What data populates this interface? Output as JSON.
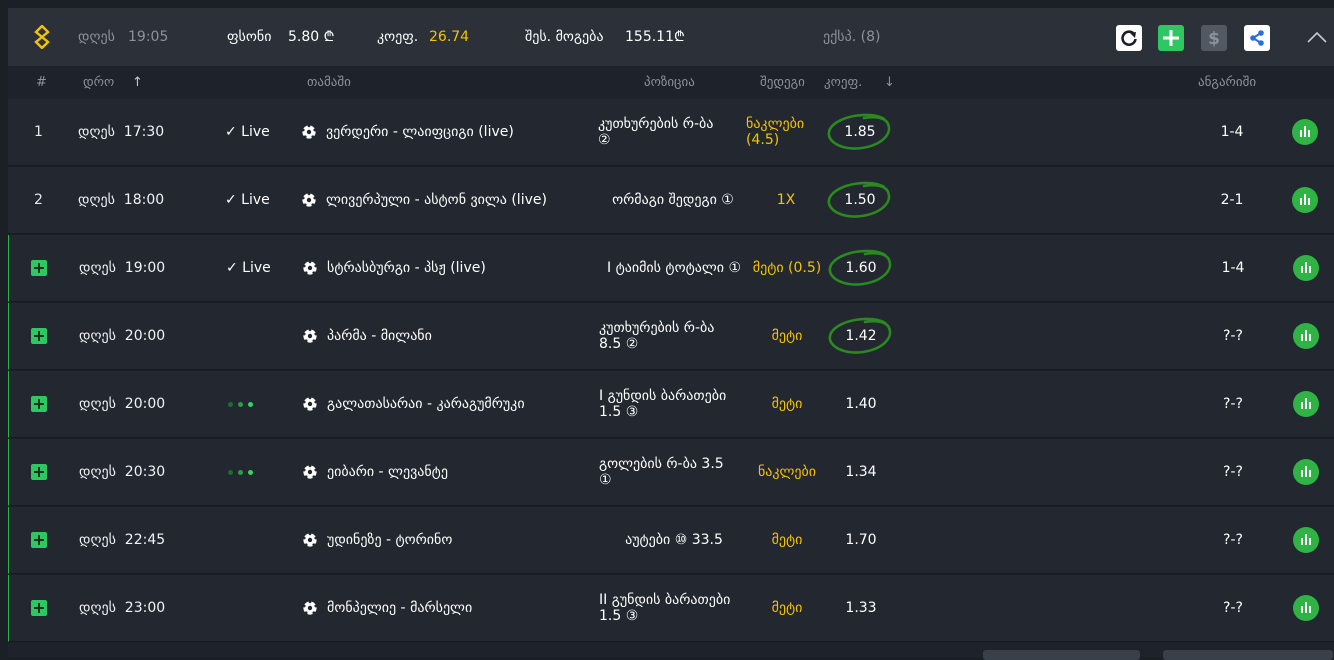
{
  "topbar": {
    "day": "დღეს",
    "time": "19:05",
    "bonus_label": "ფსონი",
    "bonus_value": "5.80 ₾",
    "coef_label": "კოეფ.",
    "coef_value": "26.74",
    "win_label": "შეს. მოგება",
    "win_value": "155.11₾",
    "express_label": "ექსპ. (8)",
    "icons": [
      "logo-icon",
      "refresh-icon",
      "add-icon",
      "dollar-icon",
      "share-icon",
      "chevron-up-icon"
    ],
    "colors": {
      "accent_yellow": "#f5c400",
      "accent_green": "#2fb344"
    }
  },
  "header": {
    "num": "#",
    "date": "დრო",
    "sort_up": "↑",
    "game": "თამაში",
    "position": "პოზიცია",
    "result": "შედეგი",
    "coef": "კოეფ.",
    "sort_down": "↓",
    "account": "ანგარიში"
  },
  "rows": [
    {
      "num": "1",
      "day": "დღეს",
      "time": "17:30",
      "live": "✓ Live",
      "match": "ვერდერი - ლაიფციგი (live)",
      "pos1": "კუთხურების რ-ბა",
      "pos2": "②",
      "sel1": "ნაკლები",
      "sel2": "(4.5)",
      "odd": "1.85",
      "score": "1-4"
    },
    {
      "num": "2",
      "day": "დღეს",
      "time": "18:00",
      "live": "✓ Live",
      "match": "ლივერპული - ასტონ ვილა (live)",
      "pos1": "ორმაგი შედეგი ①",
      "pos2": "",
      "sel1": "1X",
      "sel2": "",
      "odd": "1.50",
      "score": "2-1"
    },
    {
      "num": "",
      "day": "დღეს",
      "time": "19:00",
      "live": "✓ Live",
      "match": "სტრასბურგი - პსჟ (live)",
      "pos1": "I ტაიმის ტოტალი ①",
      "pos2": "",
      "sel1": "მეტი (0.5)",
      "sel2": "",
      "odd": "1.60",
      "score": "1-4"
    },
    {
      "num": "",
      "day": "დღეს",
      "time": "20:00",
      "live": "",
      "match": "პარმა - მილანი",
      "pos1": "კუთხურების რ-ბა",
      "pos2": "8.5 ②",
      "sel1": "მეტი",
      "sel2": "",
      "odd": "1.42",
      "score": "?-?"
    },
    {
      "num": "",
      "day": "დღეს",
      "time": "20:00",
      "live": "",
      "match": "გალათასარაი - კარაგუმრუკი",
      "pos1": "I გუნდის ბარათები",
      "pos2": "1.5 ③",
      "sel1": "მეტი",
      "sel2": "",
      "odd": "1.40",
      "score": "?-?"
    },
    {
      "num": "",
      "day": "დღეს",
      "time": "20:30",
      "live": "",
      "match": "ეიბარი - ლევანტე",
      "pos1": "გოლების რ-ბა 3.5",
      "pos2": "①",
      "sel1": "ნაკლები",
      "sel2": "",
      "odd": "1.34",
      "score": "?-?"
    },
    {
      "num": "",
      "day": "დღეს",
      "time": "22:45",
      "live": "",
      "match": "უდინეზე - ტორინო",
      "pos1": "აუტები ⑩ 33.5",
      "pos2": "",
      "sel1": "მეტი",
      "sel2": "",
      "odd": "1.70",
      "score": "?-?"
    },
    {
      "num": "",
      "day": "დღეს",
      "time": "23:00",
      "live": "",
      "match": "მონპელიე - მარსელი",
      "pos1": "II გუნდის ბარათები",
      "pos2": "1.5 ③",
      "sel1": "მეტი",
      "sel2": "",
      "odd": "1.33",
      "score": "?-?"
    }
  ]
}
